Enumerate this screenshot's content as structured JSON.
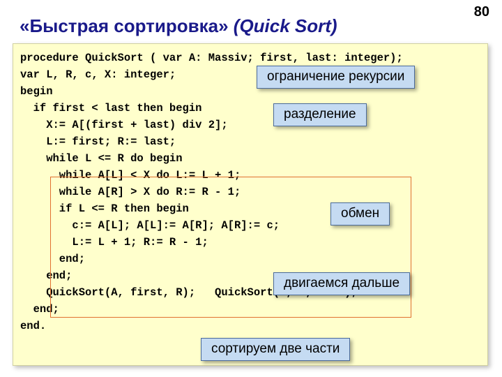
{
  "page_number": "80",
  "title_ru": "«Быстрая сортировка» ",
  "title_en": "(Quick Sort)",
  "code_lines": [
    "procedure QuickSort ( var A: Massiv; first, last: integer);",
    "var L, R, c, X: integer;",
    "begin",
    "  if first < last then begin",
    "    X:= A[(first + last) div 2];",
    "    L:= first; R:= last;",
    "    while L <= R do begin",
    "      while A[L] < X do L:= L + 1;",
    "      while A[R] > X do R:= R - 1;",
    "      if L <= R then begin",
    "        c:= A[L]; A[L]:= A[R]; A[R]:= c;",
    "        L:= L + 1; R:= R - 1;",
    "      end;",
    "    end;",
    "    QuickSort(A, first, R);   QuickSort(A, L, last);",
    "  end;",
    "end."
  ],
  "callouts": {
    "recursion_limit": "ограничение рекурсии",
    "partition": "разделение",
    "swap": "обмен",
    "move_on": "двигаемся дальше",
    "sort_two": "сортируем две части"
  }
}
